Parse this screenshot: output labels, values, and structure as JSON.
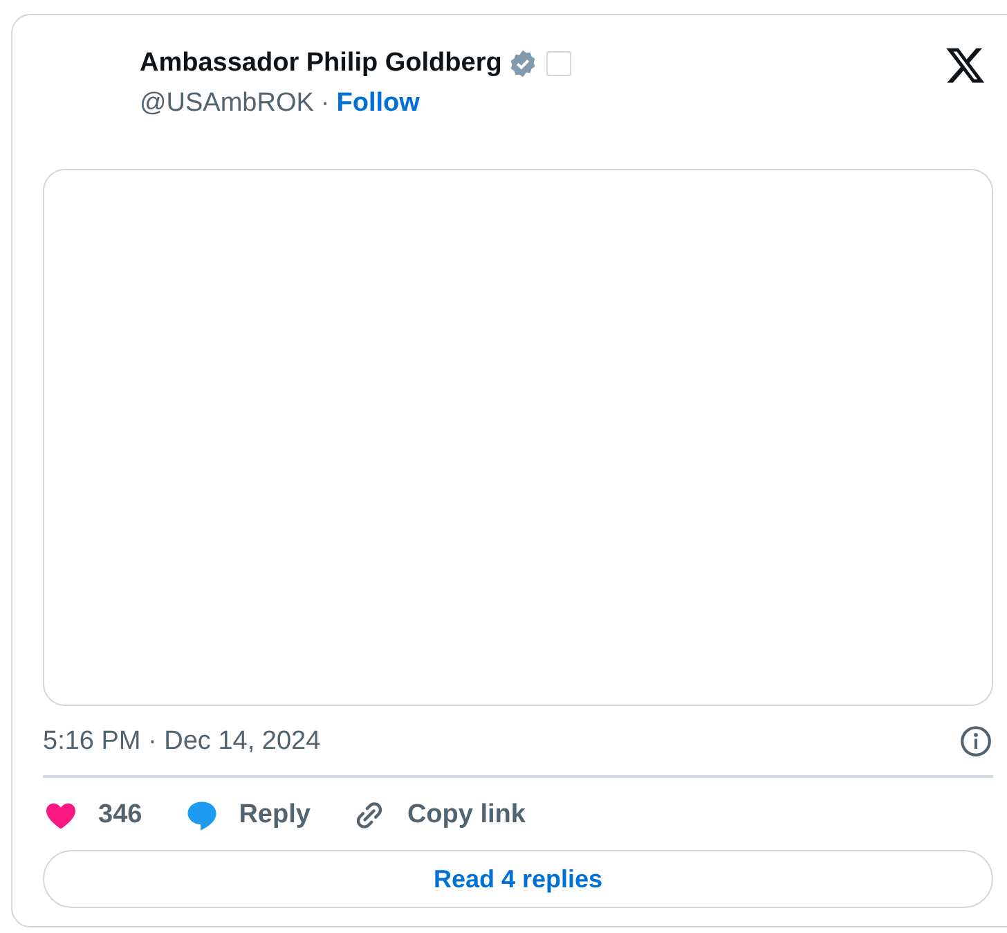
{
  "author": {
    "name": "Ambassador Philip Goldberg",
    "verified": true,
    "handle": "@USAmbROK",
    "separator": "·",
    "follow": "Follow"
  },
  "timestamp": "5:16 PM · Dec 14, 2024",
  "actions": [
    {
      "kind": "like",
      "label": "346"
    },
    {
      "kind": "reply",
      "label": "Reply"
    },
    {
      "kind": "copy",
      "label": "Copy link"
    }
  ],
  "read_replies": "Read 4 replies"
}
